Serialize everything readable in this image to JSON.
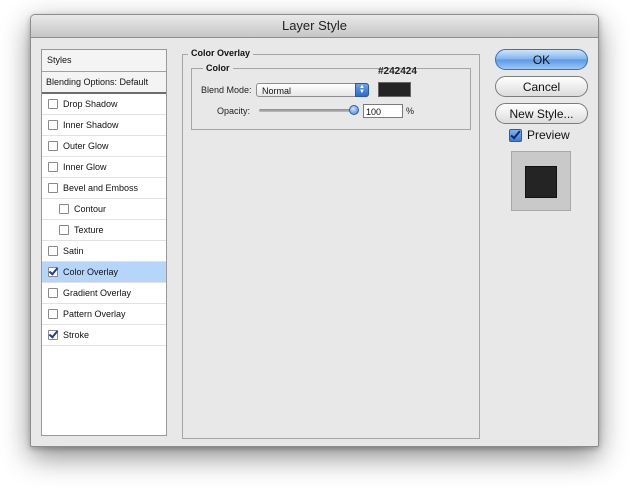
{
  "window": {
    "title": "Layer Style"
  },
  "styles_panel": {
    "header": "Styles",
    "blending_options": "Blending Options: Default",
    "items": [
      {
        "label": "Drop Shadow",
        "checked": false,
        "sub": false,
        "active": false
      },
      {
        "label": "Inner Shadow",
        "checked": false,
        "sub": false,
        "active": false
      },
      {
        "label": "Outer Glow",
        "checked": false,
        "sub": false,
        "active": false
      },
      {
        "label": "Inner Glow",
        "checked": false,
        "sub": false,
        "active": false
      },
      {
        "label": "Bevel and Emboss",
        "checked": false,
        "sub": false,
        "active": false
      },
      {
        "label": "Contour",
        "checked": false,
        "sub": true,
        "active": false
      },
      {
        "label": "Texture",
        "checked": false,
        "sub": true,
        "active": false
      },
      {
        "label": "Satin",
        "checked": false,
        "sub": false,
        "active": false
      },
      {
        "label": "Color Overlay",
        "checked": true,
        "sub": false,
        "active": true
      },
      {
        "label": "Gradient Overlay",
        "checked": false,
        "sub": false,
        "active": false
      },
      {
        "label": "Pattern Overlay",
        "checked": false,
        "sub": false,
        "active": false
      },
      {
        "label": "Stroke",
        "checked": true,
        "sub": false,
        "active": false
      }
    ]
  },
  "color_overlay": {
    "section_title": "Color Overlay",
    "group_title": "Color",
    "blend_mode_label": "Blend Mode:",
    "blend_mode_value": "Normal",
    "color_hex": "#242424",
    "opacity_label": "Opacity:",
    "opacity_value": "100",
    "opacity_unit": "%",
    "opacity_level": 1.0
  },
  "buttons": {
    "ok": "OK",
    "cancel": "Cancel",
    "new_style": "New Style..."
  },
  "preview": {
    "label": "Preview",
    "checked": true,
    "color": "#242424"
  },
  "colors": {
    "selection": "#b5d5fb",
    "accent": "#5b98e6"
  },
  "icons": {
    "select_arrows": "select-arrows-icon",
    "checkbox": "checkbox-icon"
  }
}
